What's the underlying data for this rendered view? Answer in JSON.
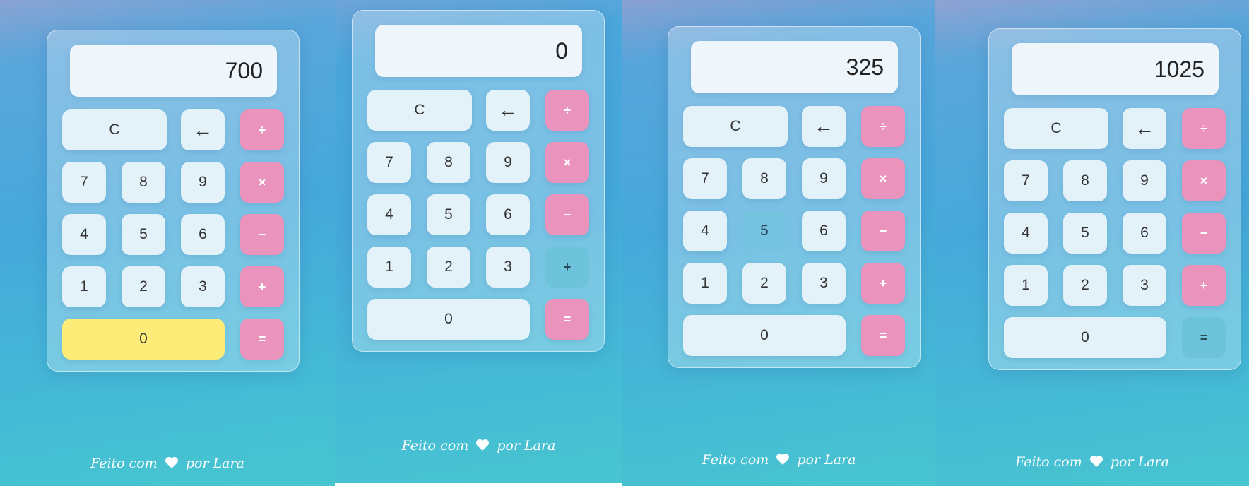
{
  "panels": [
    {
      "display": "700",
      "buttons": {
        "clear": "C",
        "backspace": "←",
        "divide": "÷",
        "multiply": "×",
        "subtract": "−",
        "add": "+",
        "equals": "=",
        "n7": "7",
        "n8": "8",
        "n9": "9",
        "n4": "4",
        "n5": "5",
        "n6": "6",
        "n1": "1",
        "n2": "2",
        "n3": "3",
        "n0": "0"
      },
      "footer": {
        "before": "Feito com",
        "after": "por Lara"
      }
    },
    {
      "display": "0",
      "buttons": {
        "clear": "C",
        "backspace": "←",
        "divide": "÷",
        "multiply": "×",
        "subtract": "−",
        "add": "+",
        "equals": "=",
        "n7": "7",
        "n8": "8",
        "n9": "9",
        "n4": "4",
        "n5": "5",
        "n6": "6",
        "n1": "1",
        "n2": "2",
        "n3": "3",
        "n0": "0"
      },
      "footer": {
        "before": "Feito com",
        "after": "por Lara"
      }
    },
    {
      "display": "325",
      "buttons": {
        "clear": "C",
        "backspace": "←",
        "divide": "÷",
        "multiply": "×",
        "subtract": "−",
        "add": "+",
        "equals": "=",
        "n7": "7",
        "n8": "8",
        "n9": "9",
        "n4": "4",
        "n5": "5",
        "n6": "6",
        "n1": "1",
        "n2": "2",
        "n3": "3",
        "n0": "0"
      },
      "footer": {
        "before": "Feito com",
        "after": "por Lara"
      }
    },
    {
      "display": "1025",
      "buttons": {
        "clear": "C",
        "backspace": "←",
        "divide": "÷",
        "multiply": "×",
        "subtract": "−",
        "add": "+",
        "equals": "=",
        "n7": "7",
        "n8": "8",
        "n9": "9",
        "n4": "4",
        "n5": "5",
        "n6": "6",
        "n1": "1",
        "n2": "2",
        "n3": "3",
        "n0": "0"
      },
      "footer": {
        "before": "Feito com",
        "after": "por Lara"
      }
    }
  ],
  "colors": {
    "operator": "#ea94bd",
    "digit": "#e3f2f8",
    "highlight_zero": "#fdec77",
    "hover": "#6cc3da",
    "display_bg": "#eef5fb"
  }
}
